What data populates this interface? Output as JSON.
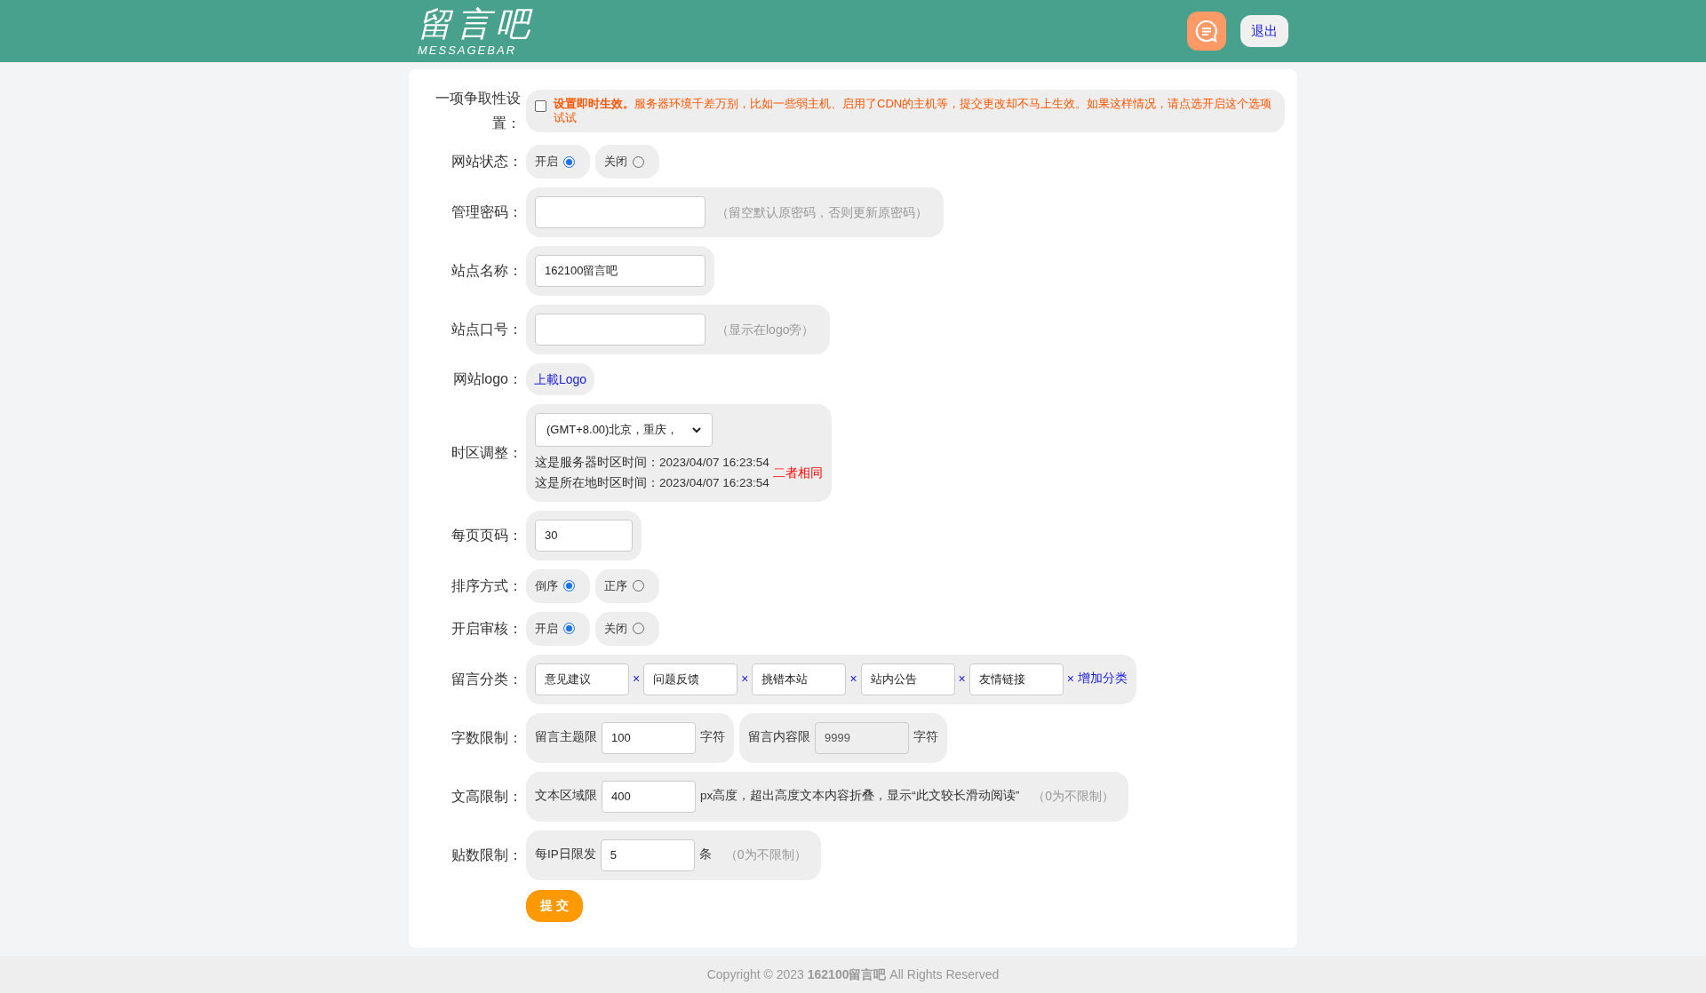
{
  "header": {
    "logo_text": "留言吧",
    "logo_subtext": "MESSAGEBAR",
    "logout": "退出"
  },
  "rows": [
    {
      "kind": "notice",
      "label": "一项争取性设置：",
      "checked": false,
      "text": "**设置即时生效。**服务器环境千差万别，比如一些弱主机、启用了CDN的主机等，提交更改却不马上生效。如果这样情况，请点选开启这个选项试试"
    },
    {
      "kind": "radio",
      "label": "网站状态：",
      "options": [
        {
          "label": "开启",
          "selected": true
        },
        {
          "label": "关闭",
          "selected": false
        }
      ]
    },
    {
      "kind": "input",
      "label": "管理密码：",
      "value": "",
      "hint": "（留空默认原密码，否则更新原密码）"
    },
    {
      "kind": "input",
      "label": "站点名称：",
      "value": "162100留言吧"
    },
    {
      "kind": "input",
      "label": "站点口号：",
      "value": "",
      "hint": "（显示在logo旁）"
    },
    {
      "kind": "link",
      "label": "网站logo：",
      "link": "上載Logo"
    },
    {
      "kind": "timezone",
      "label": "时区调整：",
      "select": "(GMT+8.00)北京，重庆，",
      "lines": [
        "这是服务器时区时间：2023/04/07 16:23:54",
        "这是所在地时区时间：2023/04/07 16:23:54"
      ],
      "note": "二者相同"
    },
    {
      "kind": "short_input",
      "label": "每页页码：",
      "value": "30"
    },
    {
      "kind": "radio",
      "label": "排序方式：",
      "options": [
        {
          "label": "倒序",
          "selected": true
        },
        {
          "label": "正序",
          "selected": false
        }
      ]
    },
    {
      "kind": "radio",
      "label": "开启审核：",
      "options": [
        {
          "label": "开启",
          "selected": true
        },
        {
          "label": "关闭",
          "selected": false
        }
      ]
    },
    {
      "kind": "tags",
      "label": "留言分类：",
      "tags": [
        {
          "value": "意见建议",
          "remove": "×"
        },
        {
          "value": "问题反馈",
          "remove": "×"
        },
        {
          "value": "挑错本站",
          "remove": "×"
        },
        {
          "value": "站内公告",
          "remove": "×"
        },
        {
          "value": "友情链接",
          "remove": "×"
        }
      ],
      "add": "增加分类"
    },
    {
      "kind": "limits",
      "label": "字数限制：",
      "groups": [
        {
          "prefix": "留言主题限",
          "value": "100",
          "suffix": "字符",
          "disabled": false
        },
        {
          "prefix": "留言内容限",
          "value": "9999",
          "suffix": "字符",
          "disabled": true
        }
      ]
    },
    {
      "kind": "limits",
      "label": "文高限制：",
      "groups": [
        {
          "prefix": "文本区域限",
          "value": "400",
          "suffix": "px高度，超出高度文本内容折叠，显示“此文较长滑动阅读”",
          "hint": "（0为不限制）",
          "disabled": false
        }
      ]
    },
    {
      "kind": "limits",
      "label": "贴数限制：",
      "groups": [
        {
          "prefix": "每IP日限发",
          "value": "5",
          "suffix": "条",
          "hint": "（0为不限制）",
          "disabled": false
        }
      ]
    }
  ],
  "submit": "提 交",
  "footer": "Copyright © 2023 **162100留言吧** All Rights Reserved"
}
